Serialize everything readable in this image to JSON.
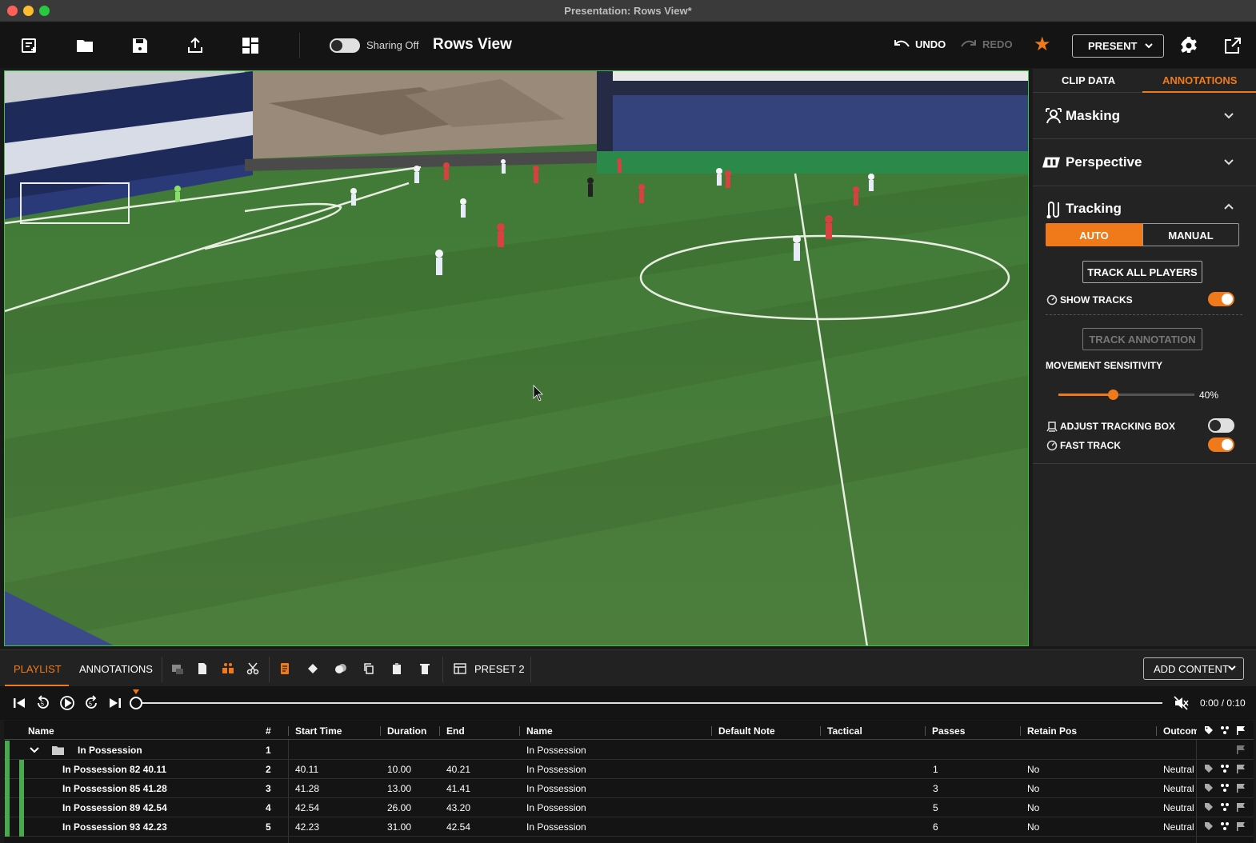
{
  "window": {
    "title": "Presentation: Rows View*"
  },
  "toolbar": {
    "icons": [
      "new-presentation-icon",
      "folder-icon",
      "save-icon",
      "export-icon",
      "layout-icon"
    ],
    "sharing_label": "Sharing Off",
    "sharing_on": false,
    "view_title": "Rows View",
    "undo_label": "UNDO",
    "redo_label": "REDO",
    "present_label": "PRESENT",
    "accent_color": "#f07a1a"
  },
  "right_panel": {
    "tabs": {
      "clip_data": "CLIP DATA",
      "annotations": "ANNOTATIONS"
    },
    "masking": {
      "title": "Masking"
    },
    "perspective": {
      "title": "Perspective"
    },
    "tracking": {
      "title": "Tracking",
      "mode_auto": "AUTO",
      "mode_manual": "MANUAL",
      "track_all_label": "TRACK ALL PLAYERS",
      "show_tracks_label": "SHOW TRACKS",
      "show_tracks_on": true,
      "track_annotation_label": "TRACK ANNOTATION",
      "movement_sensitivity_label": "MOVEMENT SENSITIVITY",
      "movement_sensitivity_value": "40%",
      "movement_sensitivity_fraction": 0.4,
      "adjust_box_label": "ADJUST TRACKING BOX",
      "adjust_box_on": false,
      "fast_track_label": "FAST TRACK",
      "fast_track_on": true
    }
  },
  "bottom_tabs": {
    "playlist": "PLAYLIST",
    "annotations": "ANNOTATIONS",
    "preset": "PRESET 2",
    "add_content": "ADD CONTENT"
  },
  "transport": {
    "timecode": "0:00 / 0:10",
    "progress": 0.0
  },
  "table": {
    "headers": {
      "name": "Name",
      "num": "#",
      "start": "Start Time",
      "duration": "Duration",
      "end": "End",
      "name2": "Name",
      "default_note": "Default Note",
      "tactical": "Tactical",
      "passes": "Passes",
      "retain_pos": "Retain Pos",
      "outcome": "Outcom"
    },
    "group": {
      "name": "In Possession",
      "num": "1",
      "name2": "In Possession"
    },
    "rows": [
      {
        "name": "In Possession 82 40.11",
        "num": "2",
        "start": "40.11",
        "duration": "10.00",
        "end": "40.21",
        "name2": "In Possession",
        "passes": "1",
        "retain_pos": "No",
        "outcome": "Neutral"
      },
      {
        "name": "In Possession 85 41.28",
        "num": "3",
        "start": "41.28",
        "duration": "13.00",
        "end": "41.41",
        "name2": "In Possession",
        "passes": "3",
        "retain_pos": "No",
        "outcome": "Neutral"
      },
      {
        "name": "In Possession 89 42.54",
        "num": "4",
        "start": "42.54",
        "duration": "26.00",
        "end": "43.20",
        "name2": "In Possession",
        "passes": "5",
        "retain_pos": "No",
        "outcome": "Neutral"
      },
      {
        "name": "In Possession 93 42.23",
        "num": "5",
        "start": "42.23",
        "duration": "31.00",
        "end": "42.54",
        "name2": "In Possession",
        "passes": "6",
        "retain_pos": "No",
        "outcome": "Neutral"
      }
    ]
  }
}
